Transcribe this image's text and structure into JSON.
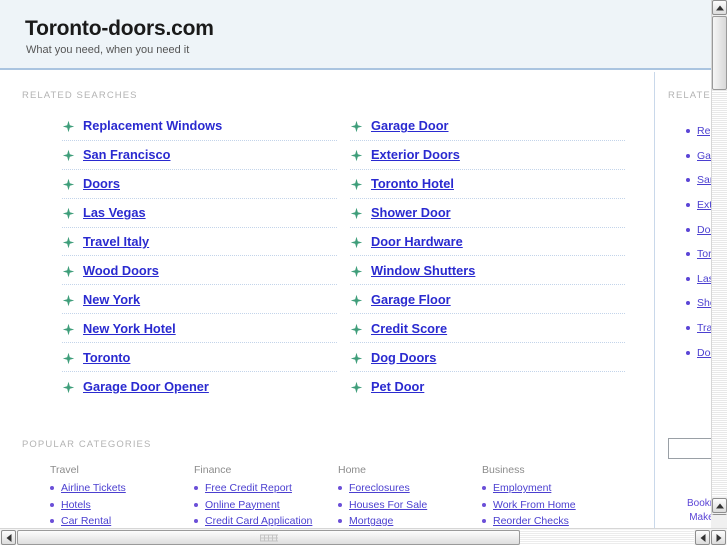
{
  "header": {
    "title": "Toronto-doors.com",
    "tagline": "What you need, when you need it"
  },
  "main": {
    "related_label": "RELATED SEARCHES",
    "categories_label": "POPULAR CATEGORIES",
    "related_searches": {
      "left_column": [
        {
          "label": "Replacement Windows",
          "underlined": false
        },
        {
          "label": "San Francisco",
          "underlined": true
        },
        {
          "label": "Doors",
          "underlined": true
        },
        {
          "label": "Las Vegas",
          "underlined": true
        },
        {
          "label": "Travel Italy",
          "underlined": true
        },
        {
          "label": "Wood Doors",
          "underlined": true
        },
        {
          "label": "New York",
          "underlined": true
        },
        {
          "label": "New York Hotel",
          "underlined": true
        },
        {
          "label": "Toronto",
          "underlined": true
        },
        {
          "label": "Garage Door Opener",
          "underlined": true
        }
      ],
      "right_column": [
        {
          "label": "Garage Door",
          "underlined": true
        },
        {
          "label": "Exterior Doors",
          "underlined": true
        },
        {
          "label": "Toronto Hotel",
          "underlined": true
        },
        {
          "label": "Shower Door",
          "underlined": true
        },
        {
          "label": "Door Hardware",
          "underlined": true
        },
        {
          "label": "Window Shutters",
          "underlined": true
        },
        {
          "label": "Garage Floor",
          "underlined": true
        },
        {
          "label": "Credit Score",
          "underlined": true
        },
        {
          "label": "Dog Doors",
          "underlined": true
        },
        {
          "label": "Pet Door",
          "underlined": true
        }
      ]
    },
    "categories": [
      {
        "heading": "Travel",
        "items": [
          "Airline Tickets",
          "Hotels",
          "Car Rental"
        ]
      },
      {
        "heading": "Finance",
        "items": [
          "Free Credit Report",
          "Online Payment",
          "Credit Card Application"
        ]
      },
      {
        "heading": "Home",
        "items": [
          "Foreclosures",
          "Houses For Sale",
          "Mortgage"
        ]
      },
      {
        "heading": "Business",
        "items": [
          "Employment",
          "Work From Home",
          "Reorder Checks"
        ]
      }
    ]
  },
  "sidebar": {
    "label": "RELATED SEARCHES",
    "items": [
      "Replacement Windows",
      "Garage Door",
      "San Francisco",
      "Exterior Doors",
      "Doors",
      "Toronto Hotel",
      "Las Vegas",
      "Shower Door",
      "Travel Italy",
      "Door Hardware"
    ],
    "search_value": "",
    "search_placeholder": "",
    "footer_links": [
      "Bookmark",
      "Make this"
    ]
  },
  "colors": {
    "header_bg": "#eef4f8",
    "header_border": "#aac4e0",
    "link_blue": "#2a2ad0",
    "small_link_blue": "#4b3fd0",
    "bullet_green": "#3f9e7a",
    "label_gray": "#b3b3b3",
    "separator": "#c3d4ea"
  },
  "scrollbars": {
    "vertical_thumb_position": "top",
    "horizontal_thumb_position": "left"
  }
}
